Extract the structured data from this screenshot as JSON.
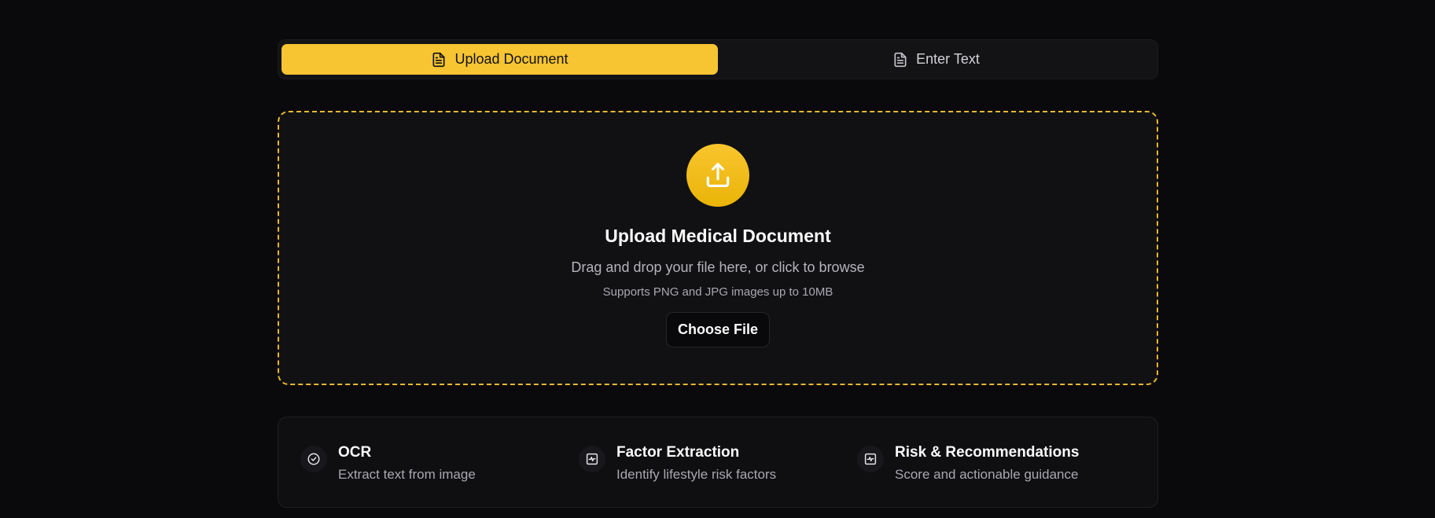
{
  "tabs": [
    {
      "label": "Upload Document",
      "icon": "file-text-icon",
      "active": true
    },
    {
      "label": "Enter Text",
      "icon": "file-text-icon",
      "active": false
    }
  ],
  "dropzone": {
    "icon": "upload-icon",
    "title": "Upload Medical Document",
    "subtitle": "Drag and drop your file here, or click to browse",
    "note": "Supports PNG and JPG images up to 10MB",
    "button_label": "Choose File"
  },
  "features": [
    {
      "icon": "check-circle-icon",
      "title": "OCR",
      "description": "Extract text from image"
    },
    {
      "icon": "activity-icon",
      "title": "Factor Extraction",
      "description": "Identify lifestyle risk factors"
    },
    {
      "icon": "activity-icon",
      "title": "Risk & Recommendations",
      "description": "Score and actionable guidance"
    }
  ],
  "colors": {
    "accent": "#f7c432",
    "background": "#0a0a0c",
    "panel": "#111114"
  }
}
